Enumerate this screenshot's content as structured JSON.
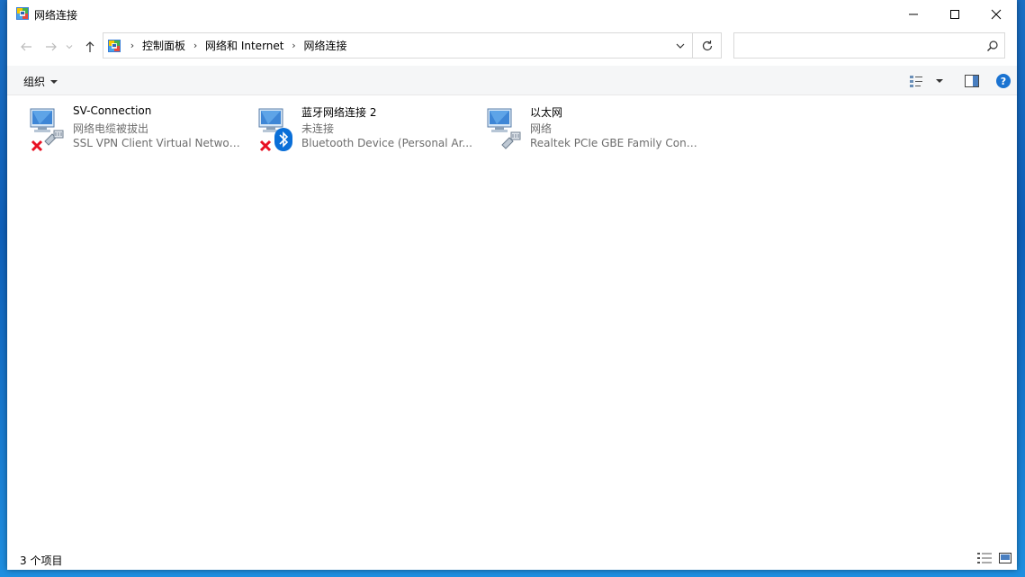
{
  "window": {
    "title": "网络连接"
  },
  "nav": {
    "breadcrumbs": [
      "控制面板",
      "网络和 Internet",
      "网络连接"
    ],
    "search_placeholder": ""
  },
  "toolbar": {
    "organize_label": "组织"
  },
  "connections": [
    {
      "name": "SV-Connection",
      "status": "网络电缆被拔出",
      "device": "SSL VPN Client Virtual Network...",
      "overlay": "red-x-icon"
    },
    {
      "name": "蓝牙网络连接 2",
      "status": "未连接",
      "device": "Bluetooth Device (Personal Ar...",
      "overlay": "bluetooth-icon"
    },
    {
      "name": "以太网",
      "status": "网络",
      "device": "Realtek PCIe GBE Family Contr...",
      "overlay": "ethernet-cable-icon"
    }
  ],
  "statusbar": {
    "item_count": "3 个项目"
  },
  "colors": {
    "accent": "#0067c0",
    "error_red": "#e81123",
    "bluetooth_blue": "#0a6fd8"
  }
}
